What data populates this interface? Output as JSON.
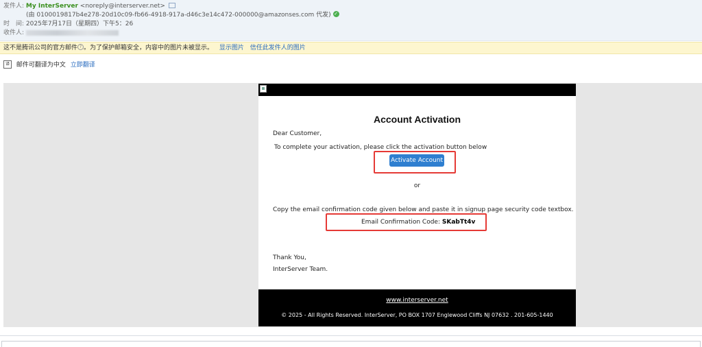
{
  "header": {
    "from_label": "发件人:",
    "sender_name": "My InterServer",
    "sender_email": "<noreply@interserver.net>",
    "via_text": "(由 0100019817b4e278-20d10c09-fb66-4918-917a-d46c3e14c472-000000@amazonses.com 代发)",
    "time_label": "时　间:",
    "time_value": "2025年7月17日（星期四）下午5：26",
    "to_label": "收件人:"
  },
  "warning": {
    "text": "这不是腾讯公司的官方邮件",
    "text2": "。为了保护邮箱安全，内容中的图片未被显示。",
    "show_images": "显示图片",
    "trust_sender": "信任此发件人的图片"
  },
  "translate": {
    "icon_glyph": "译",
    "text": "邮件可翻译为中文",
    "action": "立即翻译"
  },
  "email": {
    "title": "Account Activation",
    "greeting": "Dear Customer,",
    "instruction": "To complete your activation, please click the activation button below",
    "activate_button": "Activate Account",
    "or_text": "or",
    "copy_instruction": "Copy the email confirmation code given below and paste it in signup page security code textbox.",
    "code_label": "Email Confirmation Code:",
    "code_value": "SKabTt4v",
    "thanks": "Thank You,",
    "team": "InterServer Team.",
    "footer_link": "www.interserver.net",
    "footer_copyright": "© 2025 - All Rights Reserved. InterServer, PO BOX 1707 Englewood Cliffs NJ 07632 . 201-605-1440"
  },
  "colors": {
    "sender_name": "#3a8f1e",
    "link": "#2a6cbf",
    "warning_bg": "#fdf6cf",
    "button": "#2f7fd0",
    "highlight_box": "#e53935"
  },
  "icons": [
    "contact-card-icon",
    "verified-check-icon",
    "help-icon",
    "translate-icon",
    "broken-image-icon"
  ]
}
